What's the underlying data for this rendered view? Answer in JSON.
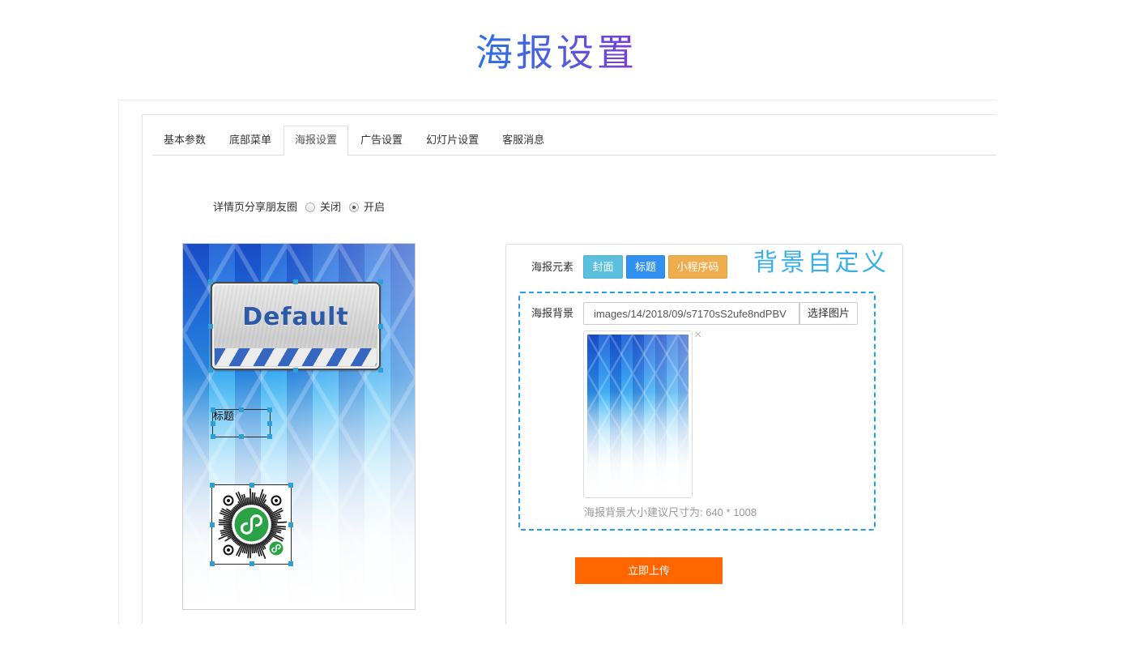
{
  "page": {
    "title": "海报设置"
  },
  "tabs": [
    {
      "label": "基本参数",
      "active": false
    },
    {
      "label": "底部菜单",
      "active": false
    },
    {
      "label": "海报设置",
      "active": true
    },
    {
      "label": "广告设置",
      "active": false
    },
    {
      "label": "幻灯片设置",
      "active": false
    },
    {
      "label": "客服消息",
      "active": false
    }
  ],
  "share_setting": {
    "label": "详情页分享朋友圈",
    "options": [
      {
        "label": "关闭",
        "checked": false
      },
      {
        "label": "开启",
        "checked": true
      }
    ]
  },
  "poster_preview": {
    "cover_text": "Default",
    "title_text": "标题",
    "qr_icon": "mini-program-code-icon"
  },
  "elements_panel": {
    "label": "海报元素",
    "buttons": [
      {
        "label": "封面",
        "color": "#5bc0de"
      },
      {
        "label": "标题",
        "color": "#3091f2"
      },
      {
        "label": "小程序码",
        "color": "#f0ad4e"
      }
    ],
    "annotation": "背景自定义"
  },
  "background_field": {
    "label": "海报背景",
    "value": "images/14/2018/09/s7170sS2ufe8ndPBV",
    "choose_button": "选择图片",
    "remove_icon": {
      "name": "close-icon",
      "glyph": "×"
    },
    "hint": "海报背景大小建议尺寸为: 640 * 1008"
  },
  "submit_button": {
    "label": "立即上传",
    "color": "#ff6600"
  },
  "colors": {
    "annotation": "#3aaee8",
    "dashed_outline": "#1ea2e8",
    "selection_handle": "#2f9fd8",
    "title_gradient": [
      "#2c72e0",
      "#7d3ad5"
    ]
  }
}
